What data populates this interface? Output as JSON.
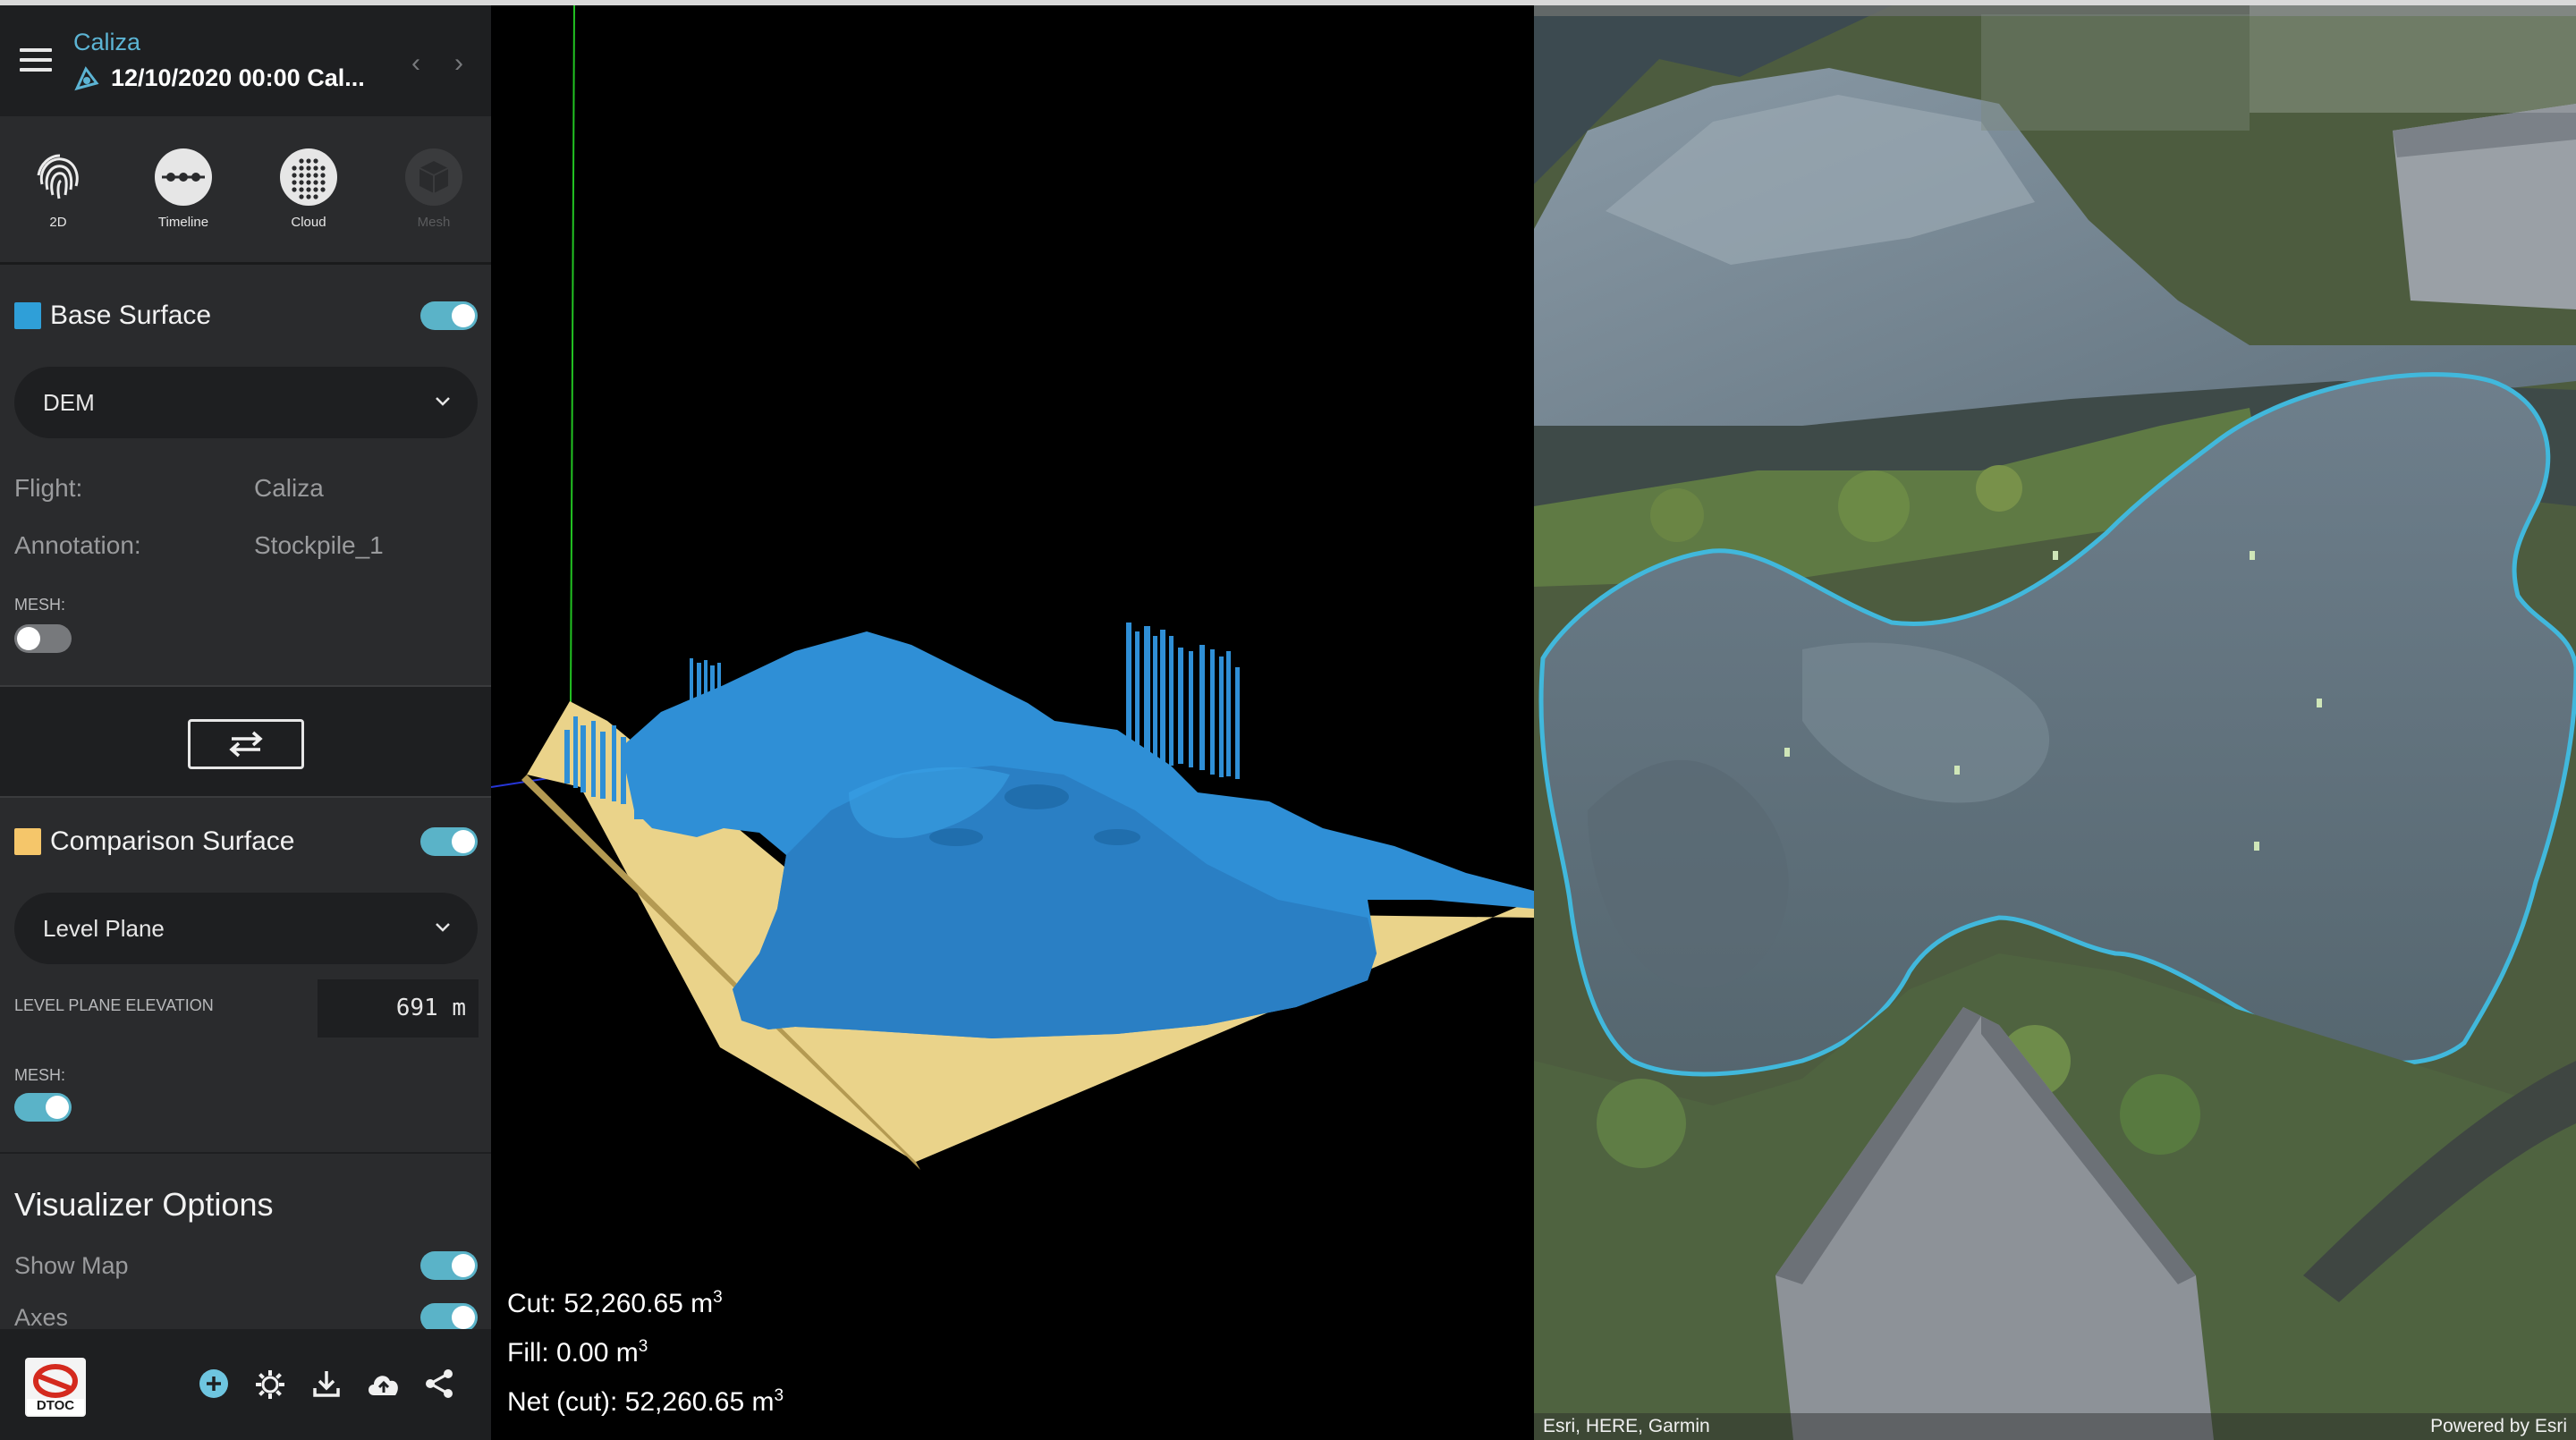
{
  "header": {
    "title": "Caliza",
    "subtitle": "12/10/2020 00:00  Cal..."
  },
  "modes": [
    {
      "label": "2D",
      "icon": "fingerprint-icon"
    },
    {
      "label": "Timeline",
      "icon": "timeline-icon"
    },
    {
      "label": "Cloud",
      "icon": "cloud-dots-icon"
    },
    {
      "label": "Mesh",
      "icon": "cube-icon"
    }
  ],
  "base_surface": {
    "label": "Base Surface",
    "color": "#2f9fd8",
    "enabled": true,
    "select_value": "DEM",
    "flight_label": "Flight:",
    "flight_value": "Caliza",
    "annotation_label": "Annotation:",
    "annotation_value": "Stockpile_1",
    "mesh_label": "MESH:",
    "mesh_enabled": false
  },
  "comparison_surface": {
    "label": "Comparison Surface",
    "color": "#f5c66a",
    "enabled": true,
    "select_value": "Level Plane",
    "elevation_label": "LEVEL PLANE ELEVATION",
    "elevation_value": "691 m",
    "mesh_label": "MESH:",
    "mesh_enabled": true
  },
  "visualizer": {
    "title": "Visualizer Options",
    "show_map_label": "Show Map",
    "show_map": true,
    "axes_label": "Axes",
    "axes": true
  },
  "footer": {
    "logo_text": "DTOC",
    "icons": [
      "add-circle-icon",
      "settings-gear-icon",
      "download-icon",
      "cloud-upload-icon",
      "share-icon"
    ]
  },
  "stats": {
    "cut_label": "Cut: 52,260.65 m",
    "fill_label": "Fill: 0.00 m",
    "net_label": "Net (cut): 52,260.65 m",
    "unit_exp": "3"
  },
  "map": {
    "attribution_left": "Esri, HERE, Garmin",
    "attribution_right": "Powered by Esri",
    "outline_color": "#41b8dc"
  }
}
